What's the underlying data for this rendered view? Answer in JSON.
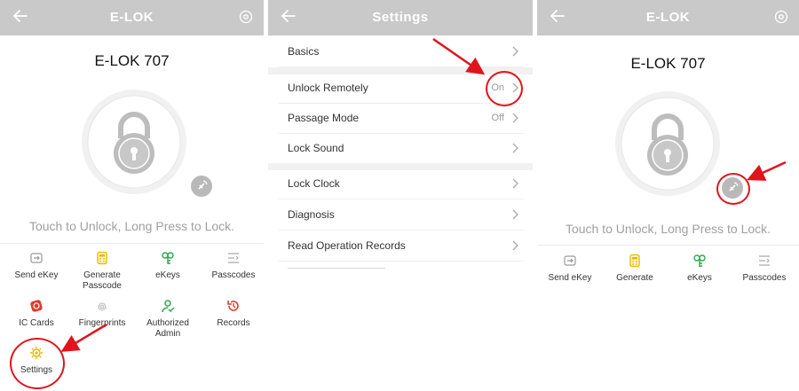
{
  "left_screen": {
    "title": "E-LOK",
    "lock_name": "E-LOK 707",
    "hint": "Touch to Unlock, Long Press to Lock.",
    "features": [
      {
        "label": "Send eKey",
        "icon": "send-ekey-icon"
      },
      {
        "label": "Generate Passcode",
        "icon": "generate-passcode-icon"
      },
      {
        "label": "eKeys",
        "icon": "ekeys-icon"
      },
      {
        "label": "Passcodes",
        "icon": "passcodes-icon"
      },
      {
        "label": "IC Cards",
        "icon": "ic-cards-icon"
      },
      {
        "label": "Fingerprints",
        "icon": "fingerprint-icon"
      },
      {
        "label": "Authorized Admin",
        "icon": "authorized-admin-icon"
      },
      {
        "label": "Records",
        "icon": "records-icon"
      },
      {
        "label": "Settings",
        "icon": "settings-icon"
      }
    ]
  },
  "middle_screen": {
    "title": "Settings",
    "rows": [
      {
        "label": "Basics",
        "value": ""
      },
      {
        "label": "Unlock Remotely",
        "value": "On"
      },
      {
        "label": "Passage Mode",
        "value": "Off"
      },
      {
        "label": "Lock Sound",
        "value": ""
      },
      {
        "label": "Lock Clock",
        "value": ""
      },
      {
        "label": "Diagnosis",
        "value": ""
      },
      {
        "label": "Read Operation Records",
        "value": ""
      }
    ]
  },
  "right_screen": {
    "title": "E-LOK",
    "lock_name": "E-LOK 707",
    "hint": "Touch to Unlock, Long Press to Lock.",
    "features": [
      {
        "label": "Send eKey"
      },
      {
        "label": "Generate"
      },
      {
        "label": "eKeys"
      },
      {
        "label": "Passcodes"
      }
    ]
  },
  "colors": {
    "header": "#c9c9c9",
    "annotation": "#e0141c",
    "yellow_icon": "#e6b800",
    "green_icon": "#2aa84a",
    "red_icon": "#e03a2f"
  }
}
